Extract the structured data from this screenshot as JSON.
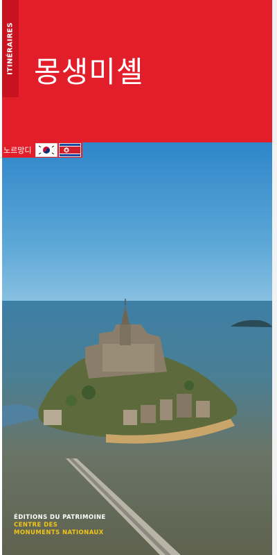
{
  "cover": {
    "series_label": "ITINÉRAIRES",
    "title": "몽생미셸",
    "region_label": "노르망디"
  },
  "flags": [
    {
      "name": "south-korea-flag"
    },
    {
      "name": "north-korea-flag"
    }
  ],
  "publisher": {
    "line1": "ÉDITIONS DU PATRIMOINE",
    "line2": "CENTRE DES",
    "line3": "MONUMENTS NATIONAUX"
  },
  "colors": {
    "header_red": "#e31e2b",
    "publisher_yellow": "#f0c419"
  }
}
